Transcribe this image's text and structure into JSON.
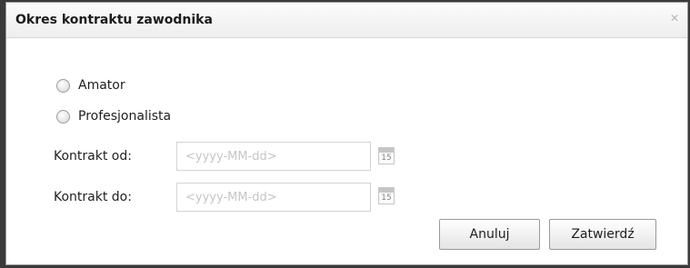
{
  "dialog": {
    "title": "Okres kontraktu zawodnika",
    "close_icon": "close-icon"
  },
  "contract_type": {
    "options": [
      {
        "label": "Amator",
        "selected": false
      },
      {
        "label": "Profesjonalista",
        "selected": false
      }
    ]
  },
  "fields": {
    "from_label": "Kontrakt od:",
    "from_placeholder": "<yyyy-MM-dd>",
    "from_value": "",
    "to_label": "Kontrakt do:",
    "to_placeholder": "<yyyy-MM-dd>",
    "to_value": "",
    "calendar_day": "15",
    "calendar_icon": "calendar-icon"
  },
  "buttons": {
    "cancel_label": "Anuluj",
    "confirm_label": "Zatwierdź"
  }
}
